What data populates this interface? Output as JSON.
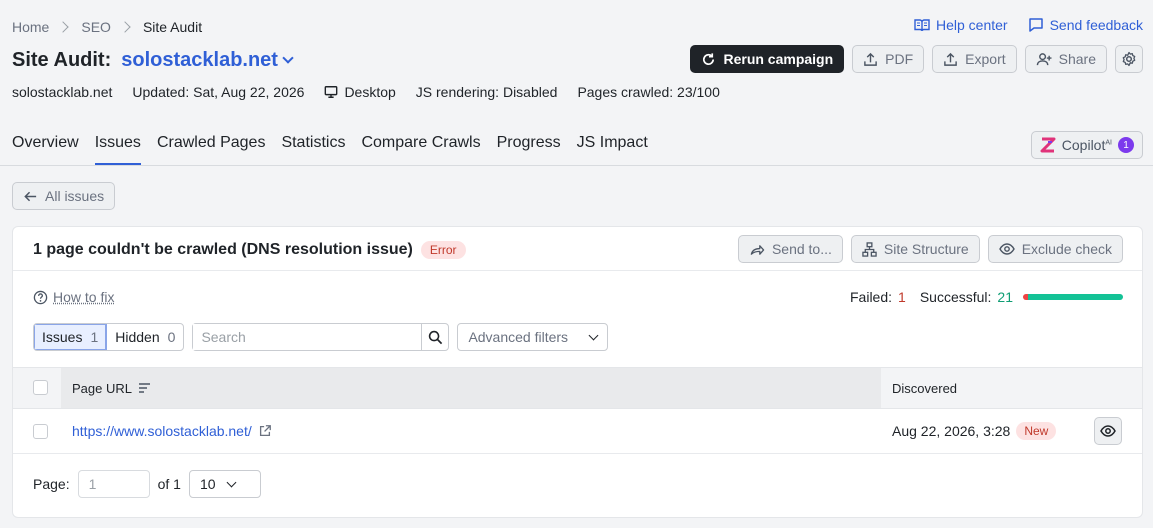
{
  "breadcrumb": [
    "Home",
    "SEO",
    "Site Audit"
  ],
  "toplinks": {
    "help": "Help center",
    "feedback": "Send feedback"
  },
  "title": {
    "prefix": "Site Audit:",
    "project": "solostacklab.net"
  },
  "actions": {
    "rerun": "Rerun campaign",
    "pdf": "PDF",
    "export": "Export",
    "share": "Share"
  },
  "meta": {
    "domain": "solostacklab.net",
    "updated": "Updated: Sat, Aug 22, 2026",
    "device": "Desktop",
    "js": "JS rendering: Disabled",
    "pages": "Pages crawled: 23/100"
  },
  "tabs": [
    "Overview",
    "Issues",
    "Crawled Pages",
    "Statistics",
    "Compare Crawls",
    "Progress",
    "JS Impact"
  ],
  "active_tab": "Issues",
  "copilot": {
    "label": "Copilot",
    "sup": "AI",
    "count": "1"
  },
  "back": "All issues",
  "issue": {
    "title": "1 page couldn't be crawled (DNS resolution issue)",
    "severity": "Error",
    "send_to": "Send to...",
    "site_structure": "Site Structure",
    "exclude": "Exclude check",
    "how_to_fix": "How to fix",
    "failed_label": "Failed:",
    "failed": "1",
    "successful_label": "Successful:",
    "successful": "21",
    "success_fraction": 0.955
  },
  "filters": {
    "issues_label": "Issues",
    "issues_count": "1",
    "hidden_label": "Hidden",
    "hidden_count": "0",
    "search_placeholder": "Search",
    "advanced": "Advanced filters"
  },
  "table": {
    "col_url": "Page URL",
    "col_discovered": "Discovered",
    "rows": [
      {
        "url": "https://www.solostacklab.net/",
        "discovered": "Aug 22, 2026, 3:28",
        "badge": "New"
      }
    ]
  },
  "pager": {
    "page_label": "Page:",
    "page_value": "1",
    "of": "of 1",
    "per_page": "10"
  },
  "colors": {
    "accent": "#2f5fd6",
    "error": "#c0392b",
    "success": "#13c296",
    "copilot": "#7c3aed"
  }
}
